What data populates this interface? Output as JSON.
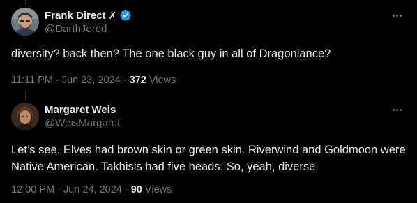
{
  "tweets": [
    {
      "display_name": "Frank Direct",
      "affiliation_badge": "✗",
      "verified": true,
      "handle": "@DarthJerod",
      "text": "diversity? back then? The one black guy in all of Dragonlance?",
      "time": "11:11 PM",
      "separator": "·",
      "date": "Jun 23, 2024",
      "views_count": "372",
      "views_label": "Views",
      "avatar_icon": "profile-photo-man-with-beard"
    },
    {
      "display_name": "Margaret Weis",
      "verified": false,
      "handle": "@WeisMargaret",
      "text": "Let’s see. Elves had brown skin or green skin. Riverwind and Goldmoon were Native American. Takhisis had five heads. So, yeah, diverse.",
      "time": "12:00 PM",
      "separator": "·",
      "date": "Jun 24, 2024",
      "views_count": "90",
      "views_label": "Views",
      "avatar_icon": "profile-photo-woman"
    }
  ],
  "colors": {
    "background": "#000000",
    "primary_text": "#e7e9ea",
    "secondary_text": "#71767b",
    "verified_blue": "#1d9bf0",
    "thread_line": "#333639"
  }
}
